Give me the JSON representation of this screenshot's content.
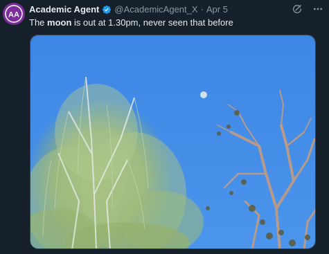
{
  "tweet": {
    "author_name": "Academic Agent",
    "handle": "@AcademicAgent_X",
    "separator": "·",
    "date": "Apr 5",
    "text_before": "The ",
    "text_bold": "moon",
    "text_after": " is out at 1.30pm, never seen that before",
    "avatar_initials": "AA",
    "verified": true
  },
  "icons": {
    "grok": "grok-icon",
    "more": "more-icon",
    "verified": "verified-badge-icon"
  },
  "colors": {
    "background": "#15202b",
    "avatar": "#7b2d9a",
    "verified": "#1d9bf0",
    "secondary_text": "#8b98a5",
    "sky": "#3f8ae6"
  }
}
